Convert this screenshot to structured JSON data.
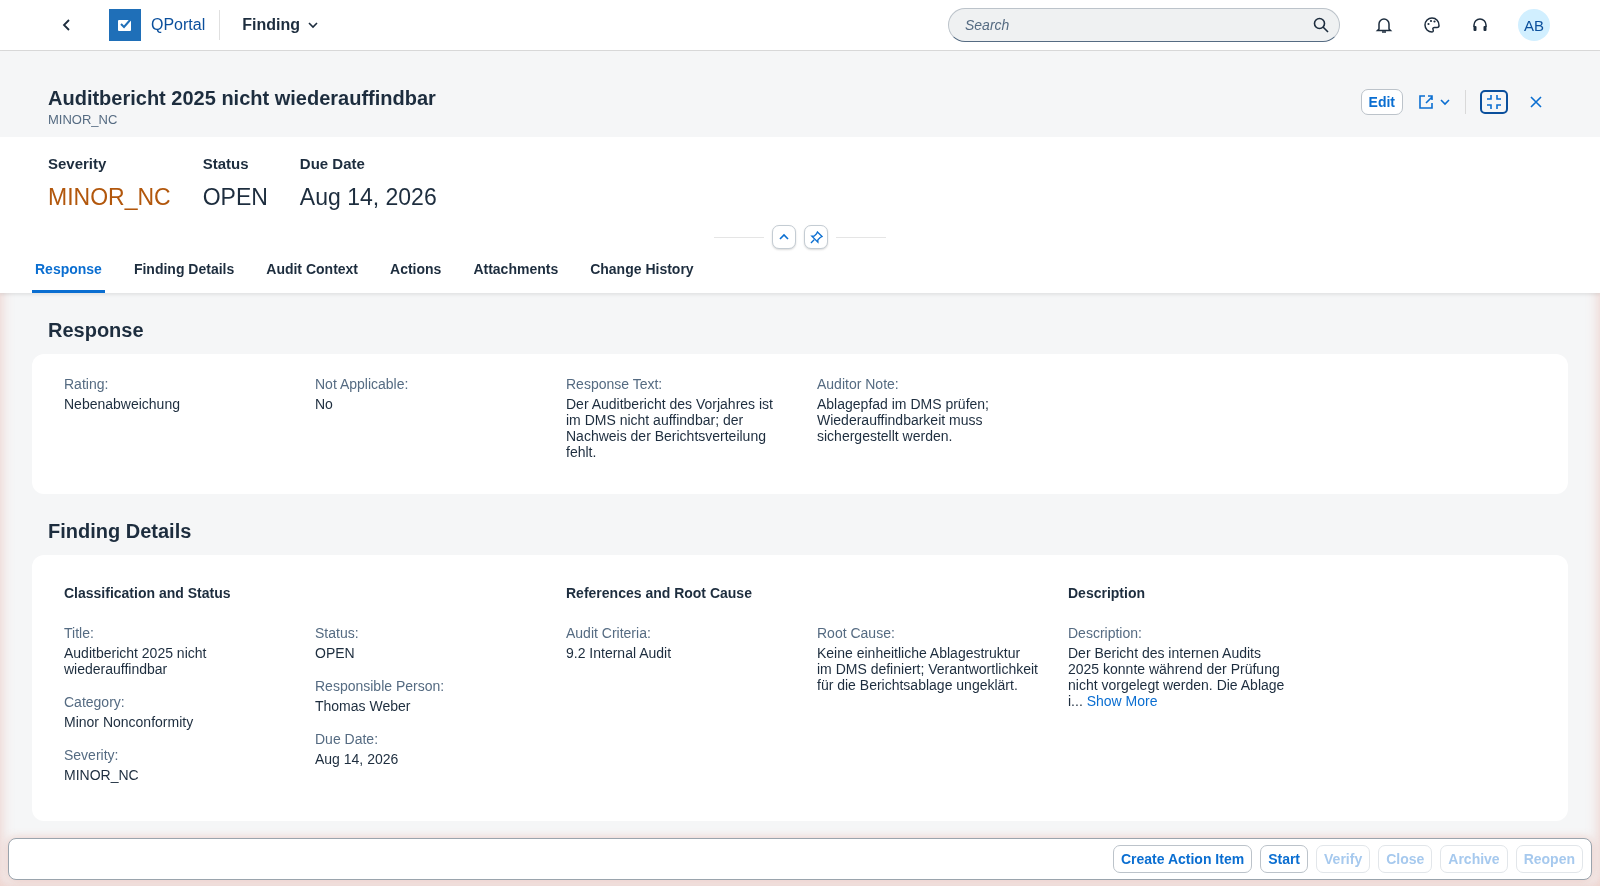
{
  "shell": {
    "app_name": "QPortal",
    "context": "Finding",
    "search": {
      "placeholder": "Search"
    },
    "avatar": "AB"
  },
  "header": {
    "title": "Auditbericht 2025 nicht wiederauffindbar",
    "subtitle": "MINOR_NC",
    "edit_button": "Edit",
    "kpis": [
      {
        "label": "Severity",
        "value": "MINOR_NC",
        "kind": "warning"
      },
      {
        "label": "Status",
        "value": "OPEN",
        "kind": "plain"
      },
      {
        "label": "Due Date",
        "value": "Aug 14, 2026",
        "kind": "plain"
      }
    ]
  },
  "tabs": [
    {
      "label": "Response",
      "selected": true
    },
    {
      "label": "Finding Details",
      "selected": false
    },
    {
      "label": "Audit Context",
      "selected": false
    },
    {
      "label": "Actions",
      "selected": false
    },
    {
      "label": "Attachments",
      "selected": false
    },
    {
      "label": "Change History",
      "selected": false
    }
  ],
  "response": {
    "title": "Response",
    "fields": [
      {
        "label": "Rating:",
        "value": "Nebenabweichung"
      },
      {
        "label": "Not Applicable:",
        "value": "No"
      },
      {
        "label": "Response Text:",
        "value": "Der Auditbericht des Vorjahres ist im DMS nicht auffindbar; der Nachweis der Berichtsverteilung fehlt."
      },
      {
        "label": "Auditor Note:",
        "value": "Ablagepfad im DMS prüfen; Wiederauffindbarkeit muss sichergestellt werden."
      }
    ]
  },
  "finding_details": {
    "title": "Finding Details",
    "groups": [
      {
        "title": "Classification and Status",
        "columns": [
          [
            {
              "label": "Title:",
              "value": "Auditbericht 2025 nicht wiederauffindbar"
            },
            {
              "label": "Category:",
              "value": "Minor Nonconformity"
            },
            {
              "label": "Severity:",
              "value": "MINOR_NC"
            }
          ],
          [
            {
              "label": "Status:",
              "value": "OPEN"
            },
            {
              "label": "Responsible Person:",
              "value": "Thomas Weber"
            },
            {
              "label": "Due Date:",
              "value": "Aug 14, 2026"
            }
          ]
        ]
      },
      {
        "title": "References and Root Cause",
        "columns": [
          [
            {
              "label": "Audit Criteria:",
              "value": "9.2 Internal Audit"
            }
          ],
          [
            {
              "label": "Root Cause:",
              "value": "Keine einheitliche Ablagestruktur im DMS definiert; Verantwortlichkeit für die Berichtsablage ungeklärt."
            }
          ]
        ]
      },
      {
        "title": "Description",
        "columns": [
          [
            {
              "label": "Description:",
              "value": "Der Bericht des internen Audits 2025 konnte während der Prüfung nicht vorgelegt werden. Die Ablage i...",
              "link": "Show More"
            }
          ]
        ]
      }
    ]
  },
  "footer": {
    "buttons": [
      {
        "label": "Create Action Item",
        "disabled": false
      },
      {
        "label": "Start",
        "disabled": false
      },
      {
        "label": "Verify",
        "disabled": true
      },
      {
        "label": "Close",
        "disabled": true
      },
      {
        "label": "Archive",
        "disabled": true
      },
      {
        "label": "Reopen",
        "disabled": true
      }
    ]
  }
}
